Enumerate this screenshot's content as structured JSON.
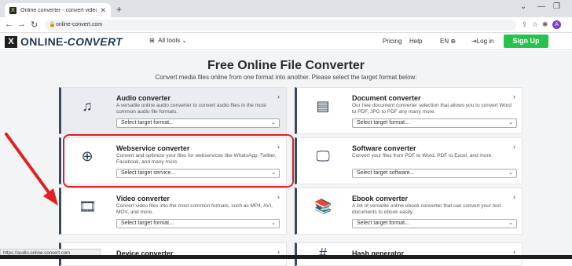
{
  "browser": {
    "tab_title": "Online converter - convert video, ×",
    "tab_title_text": "Online converter - convert video",
    "url": "online-convert.com",
    "profile_initial": "A"
  },
  "header": {
    "logo_text_1": "ONLINE-",
    "logo_text_2": "CONVERT",
    "all_tools": "All tools",
    "pricing": "Pricing",
    "help": "Help",
    "language": "EN",
    "login": "Log in",
    "signup": "Sign Up"
  },
  "main": {
    "title": "Free Online File Converter",
    "subtitle": "Convert media files online from one format into another. Please select the target format below:"
  },
  "cards": [
    {
      "title": "Audio converter",
      "desc": "A versatile online audio converter to convert audio files in the most common audio file formats.",
      "select": "Select target format...",
      "icon": "music-note-icon"
    },
    {
      "title": "Document converter",
      "desc": "Our free document converter selection that allows you to convert Word to PDF, JPG to PDF any many more.",
      "select": "Select target format...",
      "icon": "document-icon"
    },
    {
      "title": "Webservice converter",
      "desc": "Convert and optimize your files for webservices like WhatsApp, Twitter, Facebook, and many more.",
      "select": "Select target service...",
      "icon": "globe-icon"
    },
    {
      "title": "Software converter",
      "desc": "Convert your files from PDF to Word, PDF to Excel, and more.",
      "select": "Select target software...",
      "icon": "monitor-icon"
    },
    {
      "title": "Video converter",
      "desc": "Convert video files into the most common formats, such as MP4, AVI, MOV, and more.",
      "select": "Select target format...",
      "icon": "film-icon"
    },
    {
      "title": "Ebook converter",
      "desc": "A list of versatile online ebook converter that can convert your text documents to ebook easily.",
      "select": "Select target format...",
      "icon": "books-icon"
    },
    {
      "title": "Device converter",
      "desc": "",
      "select": "",
      "icon": "device-icon"
    },
    {
      "title": "Hash generator",
      "desc": "",
      "select": "",
      "icon": "hash-icon"
    }
  ],
  "status_url": "https://audio.online-convert.com",
  "colors": {
    "accent": "#27c24c",
    "highlight_box": "#e02020",
    "arrow": "#e02020"
  }
}
